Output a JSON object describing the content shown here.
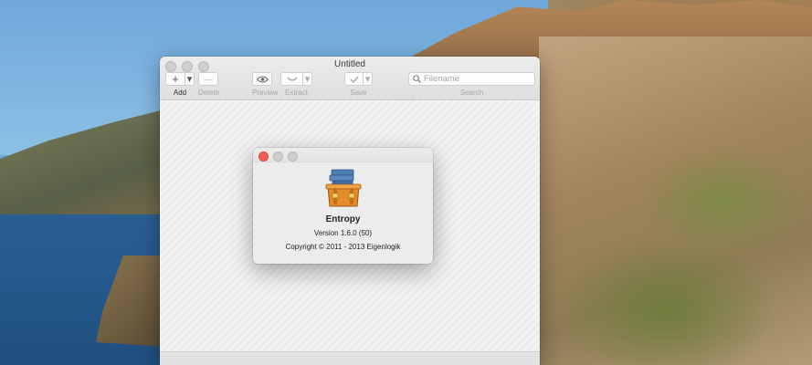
{
  "window": {
    "title": "Untitled",
    "toolbar": {
      "add_label": "Add",
      "add_glyph": "+",
      "delete_label": "Delete",
      "delete_glyph": "—",
      "preview_label": "Preview",
      "extract_label": "Extract",
      "save_label": "Save",
      "dropdown_glyph": "▾"
    },
    "search": {
      "placeholder": "Filename",
      "label": "Search"
    }
  },
  "about": {
    "app_name": "Entropy",
    "version": "Version 1.6.0 (50)",
    "copyright": "Copyright © 2011 - 2013 Eigenlogik"
  },
  "icons": [
    "search-icon",
    "eye-icon",
    "extract-icon",
    "checkmark-icon",
    "app-icon-entropy"
  ],
  "colors": {
    "close_button": "#ed5f57",
    "window_bg": "#ececec"
  }
}
